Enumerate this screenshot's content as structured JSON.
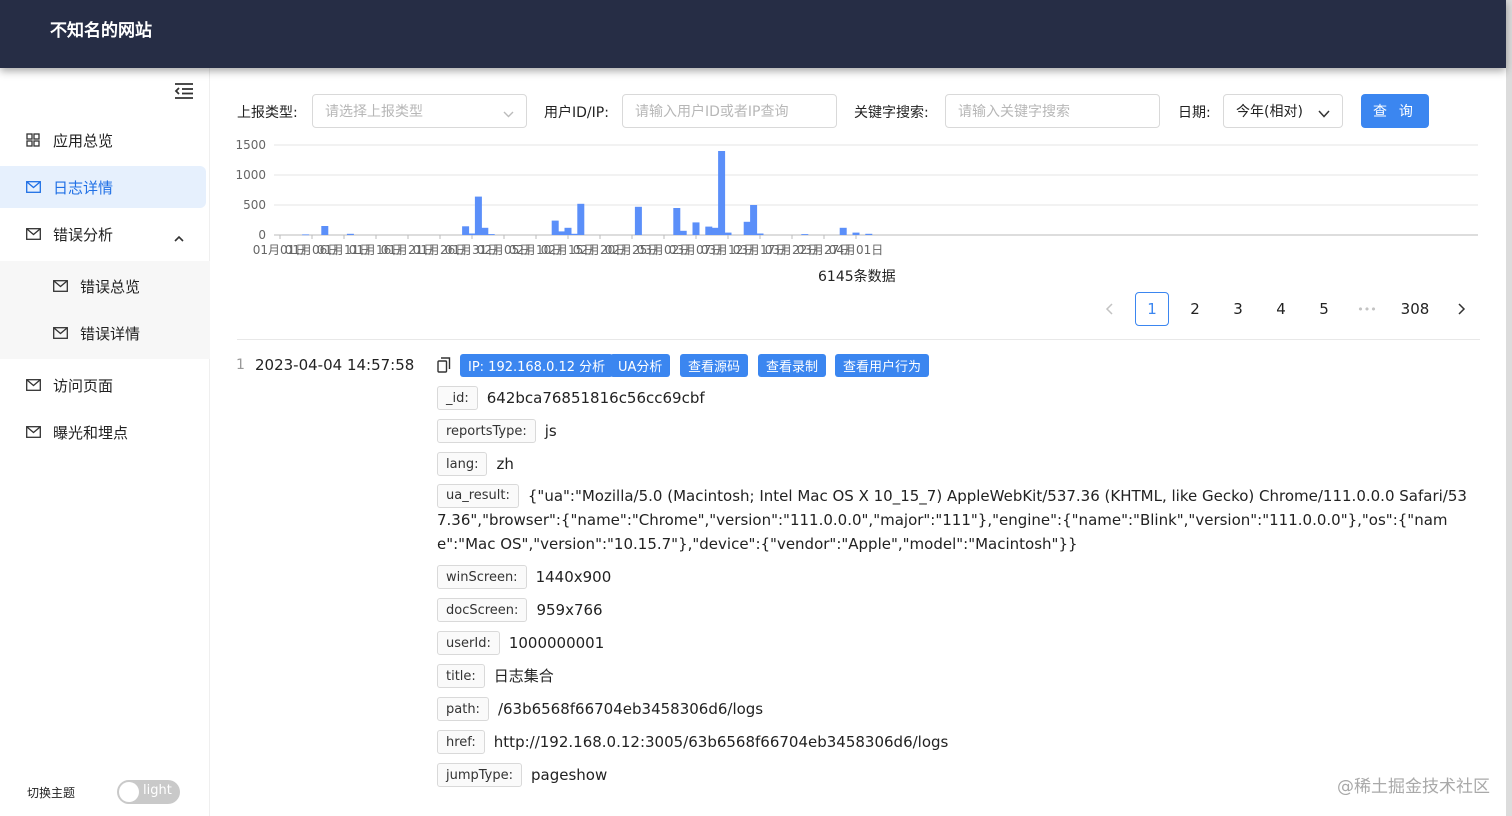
{
  "header": {
    "title": "不知名的网站"
  },
  "sidebar": {
    "items": [
      {
        "label": "应用总览",
        "icon": "grid-icon"
      },
      {
        "label": "日志详情",
        "icon": "mail-icon",
        "active": true
      },
      {
        "label": "错误分析",
        "icon": "mail-icon",
        "expanded": true
      },
      {
        "label": "错误总览",
        "icon": "mail-icon",
        "sub": true
      },
      {
        "label": "错误详情",
        "icon": "mail-icon",
        "sub": true
      },
      {
        "label": "访问页面",
        "icon": "mail-icon"
      },
      {
        "label": "曝光和埋点",
        "icon": "mail-icon"
      }
    ],
    "theme_label": "切换主题",
    "theme_value": "light"
  },
  "filters": {
    "type_label": "上报类型:",
    "type_placeholder": "请选择上报类型",
    "user_label": "用户ID/IP:",
    "user_placeholder": "请输入用户ID或者IP查询",
    "keyword_label": "关键字搜索:",
    "keyword_placeholder": "请输入关键字搜索",
    "date_label": "日期:",
    "date_value": "今年(相对)",
    "query_label": "查 询"
  },
  "chart_data": {
    "type": "bar",
    "yticks": [
      0,
      500,
      1000,
      1500
    ],
    "ylim": [
      0,
      1500
    ],
    "xticks": [
      "01月01日",
      "01月06日",
      "01月11日",
      "01月16日",
      "01月21日",
      "01月26日",
      "01月31日",
      "02月05日",
      "02月10日",
      "02月15日",
      "02月20日",
      "02月25日",
      "03月02日",
      "03月07日",
      "03月12日",
      "03月17日",
      "03月22日",
      "03月27日",
      "04月01日"
    ],
    "start_date": "2023-01-01",
    "values": [
      [
        "2023-01-05",
        10
      ],
      [
        "2023-01-08",
        150
      ],
      [
        "2023-01-12",
        20
      ],
      [
        "2023-01-30",
        145
      ],
      [
        "2023-01-31",
        25
      ],
      [
        "2023-02-01",
        640
      ],
      [
        "2023-02-02",
        120
      ],
      [
        "2023-02-03",
        15
      ],
      [
        "2023-02-13",
        240
      ],
      [
        "2023-02-14",
        60
      ],
      [
        "2023-02-15",
        120
      ],
      [
        "2023-02-16",
        20
      ],
      [
        "2023-02-17",
        520
      ],
      [
        "2023-02-26",
        470
      ],
      [
        "2023-03-04",
        450
      ],
      [
        "2023-03-05",
        70
      ],
      [
        "2023-03-07",
        210
      ],
      [
        "2023-03-09",
        140
      ],
      [
        "2023-03-10",
        120
      ],
      [
        "2023-03-11",
        1400
      ],
      [
        "2023-03-12",
        40
      ],
      [
        "2023-03-15",
        220
      ],
      [
        "2023-03-16",
        500
      ],
      [
        "2023-03-17",
        25
      ],
      [
        "2023-03-24",
        15
      ],
      [
        "2023-03-30",
        120
      ],
      [
        "2023-04-01",
        40
      ],
      [
        "2023-04-03",
        20
      ]
    ]
  },
  "total_label": "6145条数据",
  "pagination": {
    "pages": [
      "1",
      "2",
      "3",
      "4",
      "5"
    ],
    "ellipsis": "•••",
    "last": "308",
    "current": "1"
  },
  "record": {
    "index": "1",
    "time": "2023-04-04 14:57:58",
    "actions": [
      "IP: 192.168.0.12 分析",
      "UA分析",
      "查看源码",
      "查看录制",
      "查看用户行为"
    ],
    "fields": [
      {
        "key": "_id:",
        "value": "642bca76851816c56cc69cbf"
      },
      {
        "key": "reportsType:",
        "value": "js"
      },
      {
        "key": "lang:",
        "value": "zh"
      },
      {
        "key": "ua_result:",
        "value": "{\"ua\":\"Mozilla/5.0 (Macintosh; Intel Mac OS X 10_15_7) AppleWebKit/537.36 (KHTML, like Gecko) Chrome/111.0.0.0 Safari/537.36\",\"browser\":{\"name\":\"Chrome\",\"version\":\"111.0.0.0\",\"major\":\"111\"},\"engine\":{\"name\":\"Blink\",\"version\":\"111.0.0.0\"},\"os\":{\"name\":\"Mac OS\",\"version\":\"10.15.7\"},\"device\":{\"vendor\":\"Apple\",\"model\":\"Macintosh\"}}"
      },
      {
        "key": "winScreen:",
        "value": "1440x900"
      },
      {
        "key": "docScreen:",
        "value": "959x766"
      },
      {
        "key": "userId:",
        "value": "1000000001"
      },
      {
        "key": "title:",
        "value": "日志集合"
      },
      {
        "key": "path:",
        "value": "/63b6568f66704eb3458306d6/logs"
      },
      {
        "key": "href:",
        "value": "http://192.168.0.12:3005/63b6568f66704eb3458306d6/logs"
      },
      {
        "key": "jumpType:",
        "value": "pageshow"
      }
    ]
  },
  "watermark": "@稀土掘金技术社区",
  "colors": {
    "header_bg": "#262d45",
    "accent": "#3b86f0",
    "active_bg": "#e6f0fd",
    "bar": "#5b8ff9"
  }
}
